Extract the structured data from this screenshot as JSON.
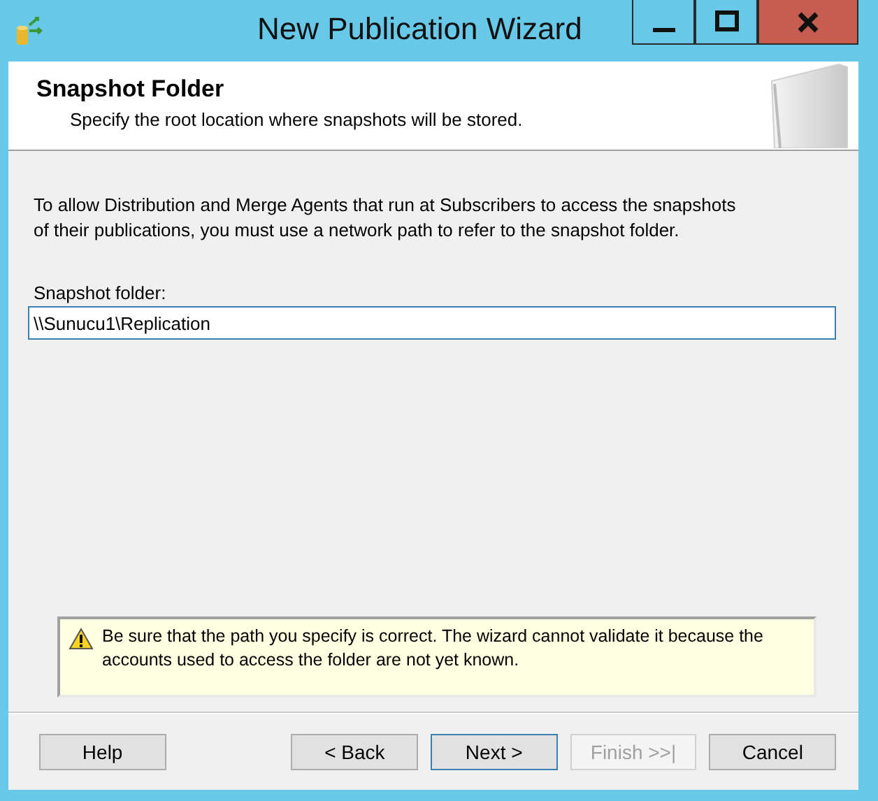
{
  "window": {
    "title": "New Publication Wizard"
  },
  "header": {
    "title": "Snapshot Folder",
    "subtitle": "Specify the root location where snapshots will be stored."
  },
  "description": "To allow Distribution and Merge Agents that run at Subscribers to access the snapshots of their publications, you must use a network path to refer to the snapshot folder.",
  "field": {
    "label": "Snapshot folder:",
    "value": "\\\\Sunucu1\\Replication"
  },
  "warning": "Be sure that the path you specify is correct. The wizard cannot validate it because the accounts used to access the folder are not yet known.",
  "buttons": [
    {
      "label": "Help",
      "disabled": false,
      "default": false
    },
    {
      "label": "< Back",
      "disabled": false,
      "default": false
    },
    {
      "label": "Next >",
      "disabled": false,
      "default": true
    },
    {
      "label": "Finish >>|",
      "disabled": true,
      "default": false
    },
    {
      "label": "Cancel",
      "disabled": false,
      "default": false
    }
  ]
}
